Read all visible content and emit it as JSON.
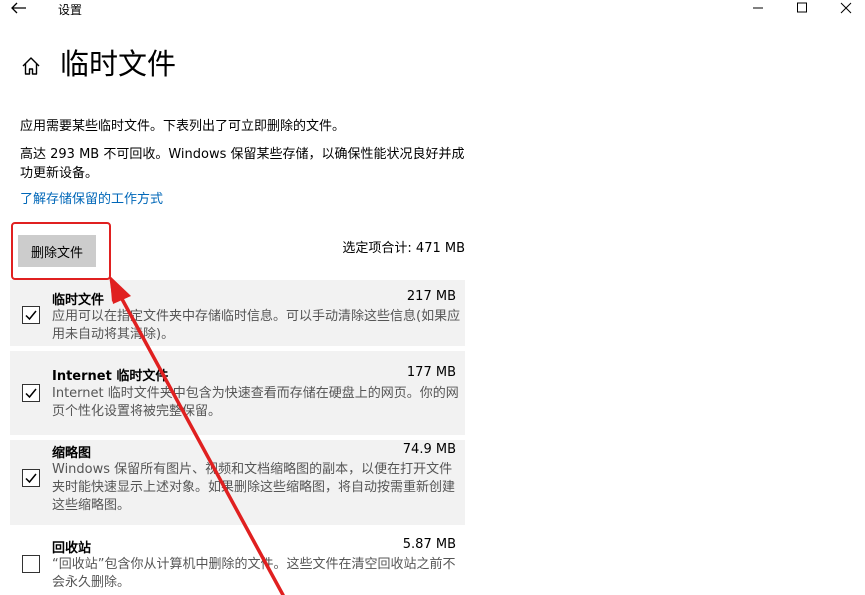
{
  "window": {
    "title": "设置"
  },
  "page": {
    "title": "临时文件",
    "description": "应用需要某些临时文件。下表列出了可立即删除的文件。",
    "reserved_note": "高达 293 MB 不可回收。Windows 保留某些存储，以确保性能状况良好并成功更新设备。",
    "learn_link": "了解存储保留的工作方式",
    "delete_button": "删除文件",
    "selected_total": "选定项合计: 471 MB"
  },
  "items": [
    {
      "name": "临时文件",
      "size": "217 MB",
      "checked": true,
      "description": "应用可以在指定文件夹中存储临时信息。可以手动清除这些信息(如果应用未自动将其清除)。"
    },
    {
      "name": "Internet 临时文件",
      "size": "177 MB",
      "checked": true,
      "description": "Internet 临时文件夹中包含为快速查看而存储在硬盘上的网页。你的网页个性化设置将被完整保留。"
    },
    {
      "name": "缩略图",
      "size": "74.9 MB",
      "checked": true,
      "description": "Windows 保留所有图片、视频和文档缩略图的副本，以便在打开文件夹时能快速显示上述对象。如果删除这些缩略图，将自动按需重新创建这些缩略图。"
    },
    {
      "name": "回收站",
      "size": "5.87 MB",
      "checked": false,
      "description": "“回收站”包含你从计算机中删除的文件。这些文件在清空回收站之前不会永久删除。"
    }
  ],
  "icons": {
    "back": "back-arrow-icon",
    "home": "home-icon",
    "minimize": "minimize-icon",
    "maximize": "maximize-icon",
    "close": "close-icon",
    "check": "checkmark-icon"
  },
  "colors": {
    "link": "#0067b8",
    "annotation": "#e02020",
    "selected_item_bg": "#f2f2f2",
    "button_bg": "#cccccc"
  }
}
